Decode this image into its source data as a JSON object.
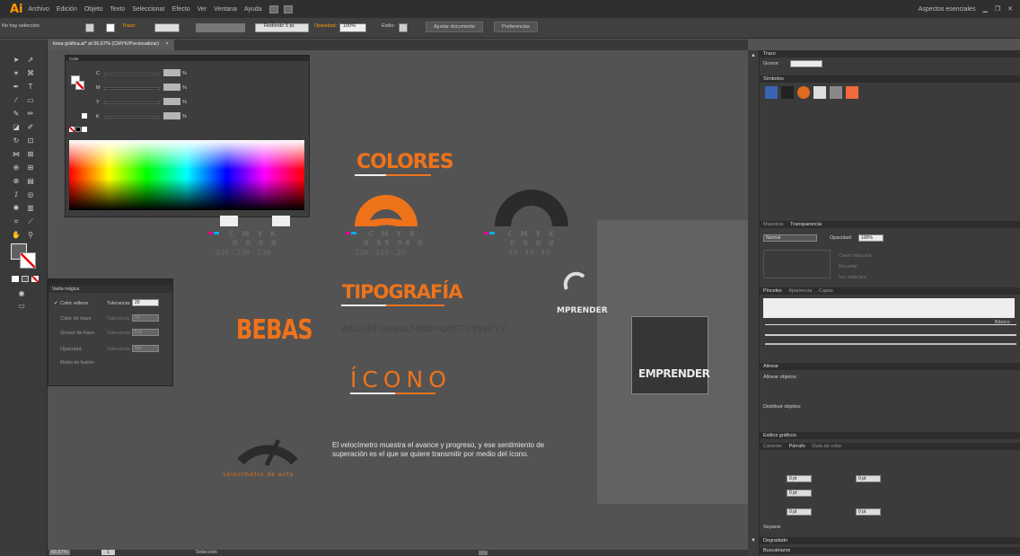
{
  "app": {
    "logo": "Ai",
    "workspace": "Aspectos esenciales"
  },
  "menu": [
    "Archivo",
    "Edición",
    "Objeto",
    "Texto",
    "Seleccionar",
    "Efecto",
    "Ver",
    "Ventana",
    "Ayuda"
  ],
  "control_bar": {
    "selection": "No hay selección",
    "stroke_label": "Trazo:",
    "brush": "Redondo 5 pt.",
    "opacity_label": "Opacidad:",
    "opacity_value": "100%",
    "style_label": "Estilo:",
    "doc_setup": "Ajustar documento",
    "preferences": "Preferencias"
  },
  "document_tab": {
    "title": "linea gráfica.ai* at 66,67% (CMYK/Previsualizar)",
    "close": "×"
  },
  "color_panel": {
    "title": "Color",
    "channels": [
      "C",
      "M",
      "Y",
      "K"
    ],
    "unit": "%"
  },
  "magic_wand": {
    "title": "Varita mágica",
    "rows": [
      {
        "label": "Color relleno",
        "check": "✓",
        "tol_label": "Tolerancia:",
        "tol": "20"
      },
      {
        "label": "Color de trazo",
        "check": "",
        "tol_label": "Tolerancia:",
        "tol": "20"
      },
      {
        "label": "Grosor de trazo",
        "check": "",
        "tol_label": "Tolerancia:",
        "tol": "5 pt"
      },
      {
        "label": "Opacidad",
        "check": "",
        "tol_label": "Tolerancia:",
        "tol": "5%"
      },
      {
        "label": "Modo de fusión",
        "check": "",
        "tol_label": "",
        "tol": ""
      }
    ]
  },
  "artboard": {
    "colores_title": "COLORES",
    "cmyk_header": "C M Y K",
    "swatches": [
      {
        "cmyk": "0 0 0 0",
        "rgb": "239 - 239 - 239",
        "color": "#efefef"
      },
      {
        "cmyk": "0 65 94 0",
        "rgb": "238 - 115 - 27",
        "color": "#ee731b"
      },
      {
        "cmyk": "0 0 0 0",
        "rgb": "43 - 43 - 43",
        "color": "#2b2b2b"
      }
    ],
    "tipografia_title": "TIPOGRAFÍA",
    "font_name": "BEBAS",
    "alphabet": "ABCDEFGHIJKLMNOPQRSTUVWXYZ",
    "icono_title": "ÍCONO",
    "small_logo_text": "MPRENDER",
    "big_logo_text": "EMPRENDER",
    "icon_caption": "velocímetro de auto",
    "description": "El velocímetro muestra el avance y progreso, y ese sentimiento de superación es el que se quiere transmitir por medio del ícono."
  },
  "status_bar": {
    "zoom": "66,67%",
    "page": "1",
    "tool": "Selección"
  },
  "right_panels": {
    "trazo": {
      "title": "Trazo",
      "grosor": "Grosor:"
    },
    "simbolos": {
      "title": "Símbolos"
    },
    "transparencia": {
      "tabs": [
        "Muestras",
        "Transparencia"
      ],
      "mode": "Normal",
      "opacity_label": "Opacidad:",
      "opacity": "100%",
      "buttons": [
        "Crear máscara",
        "Recortar",
        "Inv. máscara"
      ]
    },
    "pinceles": {
      "tabs": [
        "Pinceles",
        "Apariencia",
        "Capas"
      ],
      "basic": "Básico"
    },
    "alinear": {
      "title": "Alinear",
      "align": "Alinear objetos:",
      "distribute": "Distribuir objetos:"
    },
    "estilos": {
      "title": "Estilos gráficos"
    },
    "parrafo": {
      "tabs": [
        "Carácter",
        "Párrafo",
        "Guía de color"
      ],
      "values": [
        "0 pt",
        "0 pt",
        "0 pt",
        "0 pt",
        "0 pt"
      ],
      "separar": "Separar"
    },
    "degradado": {
      "title": "Degradado"
    },
    "buscatrazos": {
      "title": "Buscatrazos"
    }
  },
  "colors": {
    "accent": "#ee731b",
    "panel": "#3b3b3b",
    "canvas": "#535353"
  }
}
